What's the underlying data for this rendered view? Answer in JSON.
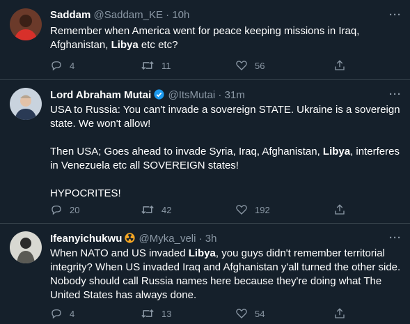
{
  "tweets": [
    {
      "name": "Saddam",
      "handle": "@Saddam_KE",
      "time": "10h",
      "text_parts": [
        "Remember when America went for peace keeping missions in Iraq, Afghanistan, ",
        "Libya",
        " etc etc?"
      ],
      "replies": "4",
      "retweets": "11",
      "likes": "56"
    },
    {
      "name": "Lord Abraham Mutai",
      "handle": "@ItsMutai",
      "time": "31m",
      "verified": true,
      "text_parts": [
        "USA to Russia: You can't invade a sovereign STATE. Ukraine is a sovereign state. We won't allow!\n\nThen USA; Goes ahead to invade Syria, Iraq, Afghanistan, ",
        "Libya",
        ", interferes in Venezuela etc all SOVEREIGN states!\n\nHYPOCRITES!"
      ],
      "replies": "20",
      "retweets": "42",
      "likes": "192"
    },
    {
      "name": "Ifeanyichukwu",
      "handle": "@Myka_veli",
      "time": "3h",
      "badge_icon": "radioactive-icon",
      "text_parts": [
        "When NATO and US invaded ",
        "Libya",
        ", you guys didn't remember territorial integrity? When US invaded Iraq and Afghanistan y'all turned the other side. Nobody should call Russia names here because they're doing what The United States has always done."
      ],
      "replies": "4",
      "retweets": "13",
      "likes": "54"
    }
  ],
  "separator": "·",
  "more_label": "···",
  "colors": {
    "background": "#15202b",
    "text": "#ffffff",
    "muted": "#8b98a5",
    "border": "#38444d",
    "verified": "#1d9bf0",
    "badge": "#f5a623"
  }
}
